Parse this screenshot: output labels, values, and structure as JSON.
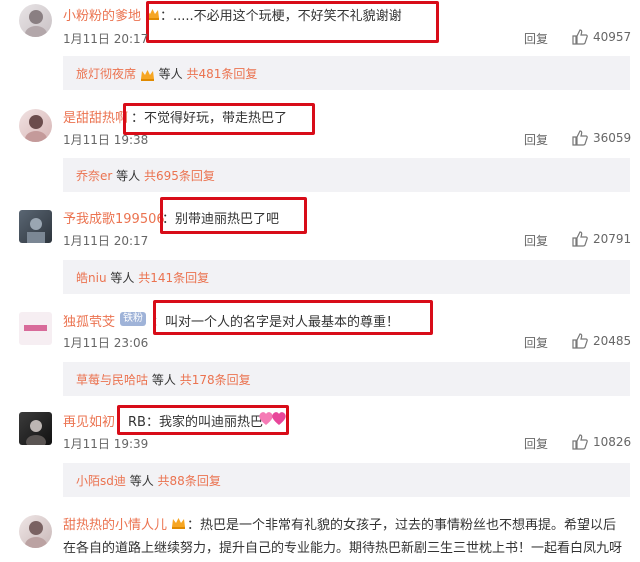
{
  "comments": [
    {
      "username": "小粉粉的爹地",
      "text": "：.....不必用这个玩梗，不好笑不礼貌谢谢",
      "date": "1月11日 20:17",
      "reply": "回复",
      "likes": "40957",
      "sub": {
        "name": "旅灯彻夜席",
        "suffix": "等人",
        "total": "共481条回复"
      }
    },
    {
      "username": "是甜甜热啊",
      "text": "：不觉得好玩，带走热巴了",
      "date": "1月11日 19:38",
      "reply": "回复",
      "likes": "36059",
      "sub": {
        "name": "乔奈er",
        "suffix": "等人",
        "total": "共695条回复"
      }
    },
    {
      "username": "予我成歌199506",
      "text": "：别带迪丽热巴了吧",
      "date": "1月11日 20:17",
      "reply": "回复",
      "likes": "20791",
      "sub": {
        "name": "皓niu",
        "suffix": "等人",
        "total": "共141条回复"
      }
    },
    {
      "username": "独孤茕芠",
      "badge": "铁粉",
      "text": "：叫对一个人的名字是对人最基本的尊重！",
      "date": "1月11日 23:06",
      "reply": "回复",
      "likes": "20485",
      "sub": {
        "name": "草莓与民哈咕",
        "suffix": "等人",
        "total": "共178条回复"
      }
    },
    {
      "username": "再见如初",
      "text": "：RB：我家的叫迪丽热巴",
      "date": "1月11日 19:39",
      "reply": "回复",
      "likes": "10826",
      "sub": {
        "name": "小陌sd迪",
        "suffix": "等人",
        "total": "共88条回复"
      }
    },
    {
      "username": "甜热热的小情人儿",
      "text_line1": "：热巴是一个非常有礼貌的女孩子，过去的事情粉丝也不想再提。希望以后",
      "text_line2": "在各自的道路上继续努力，提升自己的专业能力。期待热巴新剧三生三世枕上书！一起看白凤九呀"
    }
  ],
  "colors": {
    "username": "#eb7350",
    "highlight_box": "#d80c18",
    "sub_bg": "#f2f2f5"
  }
}
